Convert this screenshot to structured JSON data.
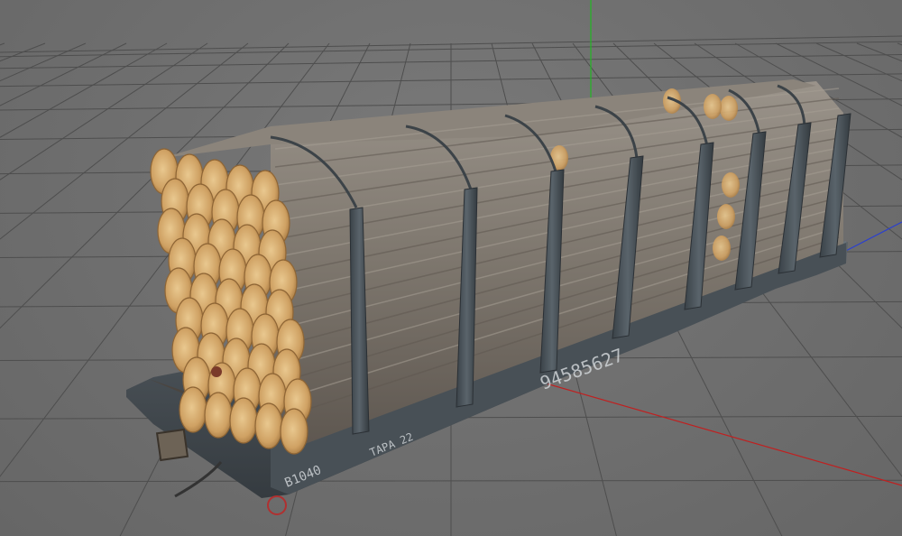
{
  "viewport": {
    "background_color": "#707070",
    "grid_color": "#4e4e4e",
    "axis_colors": {
      "x": "#c02020",
      "y": "#22b822",
      "z": "#2a3fd0"
    }
  },
  "model": {
    "type": "flatcar loaded with logs",
    "car_number": "94585627",
    "side_marking_left": "B1040",
    "side_marking_short": "ТАРА 22",
    "colors": {
      "frame": "#4a5157",
      "stake": "#3e464c",
      "bark": "#7f786f",
      "log_end": "#d2a76a",
      "deck": "#4b4540"
    }
  }
}
